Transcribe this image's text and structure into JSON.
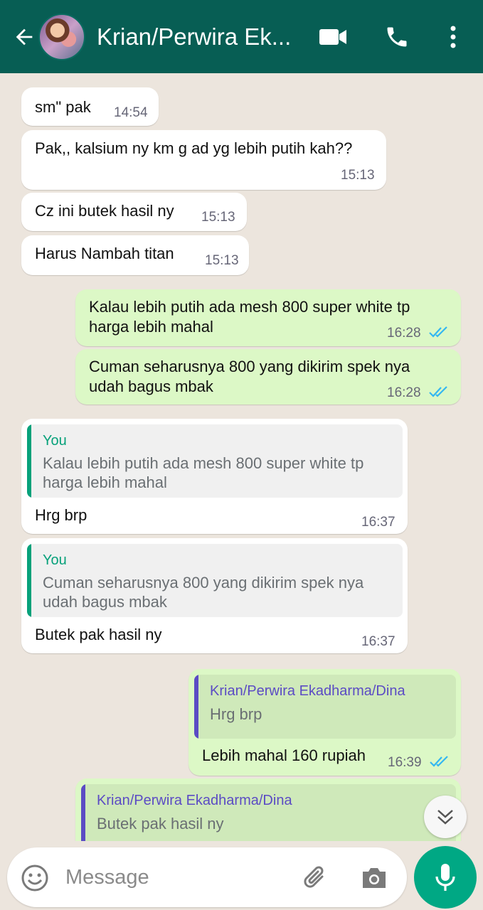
{
  "header": {
    "title": "Krian/Perwira Ek...",
    "icons": [
      "back-arrow-icon",
      "video-call-icon",
      "phone-icon",
      "more-vert-icon"
    ]
  },
  "messages": [
    {
      "dir": "in",
      "text": "sm\" pak",
      "time": "14:54"
    },
    {
      "dir": "in",
      "text": "Pak,,  kalsium ny km g ad yg lebih putih kah??",
      "time": "15:13"
    },
    {
      "dir": "in",
      "text": "Cz ini butek hasil ny",
      "time": "15:13"
    },
    {
      "dir": "in",
      "text": "Harus Nambah titan",
      "time": "15:13"
    },
    {
      "dir": "out",
      "text_lines": [
        "Kalau lebih putih ada mesh 800 super white tp",
        "harga lebih mahal"
      ],
      "time": "16:28",
      "status": "read"
    },
    {
      "dir": "out",
      "text_lines": [
        "Cuman seharusnya 800 yang dikirim spek nya",
        "udah bagus mbak"
      ],
      "time": "16:28",
      "status": "read"
    },
    {
      "dir": "in",
      "quote_name": "You",
      "quote_lines": [
        "Kalau lebih putih ada mesh 800 super white tp",
        "harga lebih mahal"
      ],
      "text": "Hrg brp",
      "time": "16:37"
    },
    {
      "dir": "in",
      "quote_name": "You",
      "quote_lines": [
        "Cuman seharusnya 800 yang dikirim spek nya",
        "udah bagus mbak"
      ],
      "text": "Butek pak hasil ny",
      "time": "16:37"
    },
    {
      "dir": "out",
      "quote_name": "Krian/Perwira Ekadharma/Dina",
      "quote_lines": [
        "Hrg brp"
      ],
      "text": "Lebih mahal 160 rupiah",
      "time": "16:39",
      "status": "read"
    },
    {
      "dir": "out",
      "quote_name": "Krian/Perwira Ekadharma/Dina",
      "quote_lines": [
        "Butek pak hasil ny"
      ]
    }
  ],
  "input": {
    "placeholder": "Message",
    "icons": [
      "emoji-icon",
      "attach-icon",
      "camera-icon",
      "mic-icon"
    ]
  },
  "colors": {
    "header": "#075E54",
    "incoming": "#FFFFFF",
    "outgoing": "#DCF8C6",
    "you_accent": "#06A17A",
    "contact_accent": "#5B4BC4",
    "ticks": "#34B7F1",
    "mic_button": "#00A884"
  }
}
